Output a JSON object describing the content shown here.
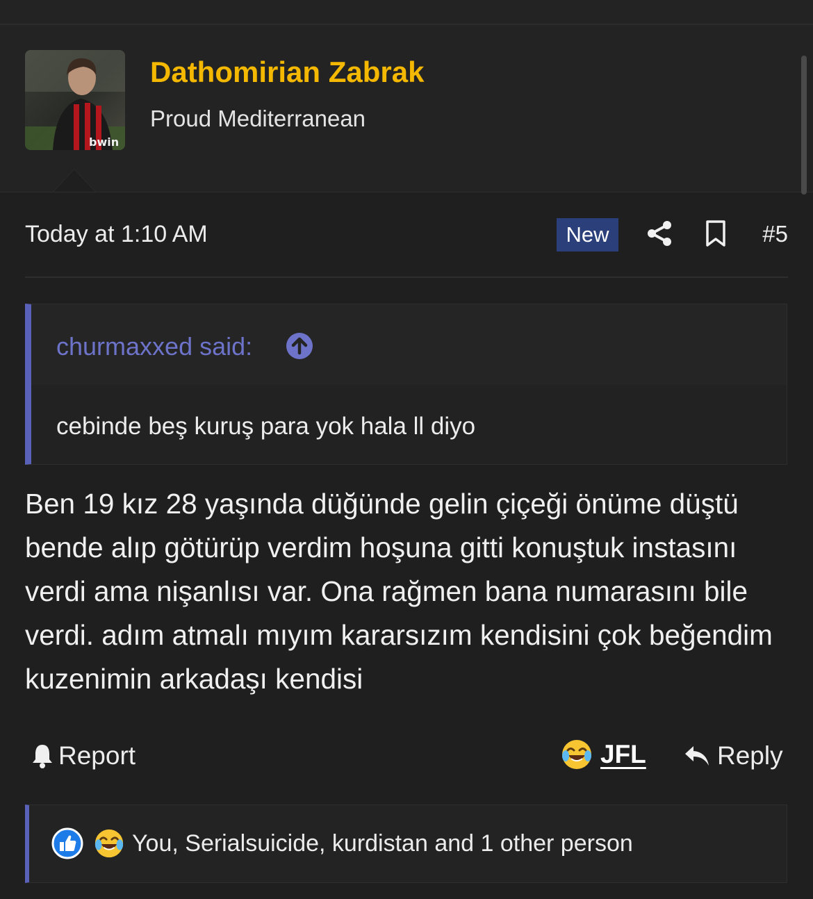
{
  "user": {
    "name": "Dathomirian Zabrak",
    "title": "Proud Mediterranean"
  },
  "post": {
    "timestamp": "Today at 1:10 AM",
    "badge": "New",
    "number": "#5",
    "quote": {
      "author": "churmaxxed said:",
      "text": "cebinde beş kuruş para yok hala ll diyo"
    },
    "body": "Ben 19 kız 28 yaşında düğünde gelin çiçeği önüme düştü bende alıp götürüp verdim hoşuna gitti konuştuk instasını verdi ama nişanlısı var. Ona rağmen bana numarasını bile verdi. adım atmalı mıyım kararsızım kendisini çok beğendim kuzenimin arkadaşı kendisi"
  },
  "actions": {
    "report": "Report",
    "reaction": "JFL",
    "reply": "Reply"
  },
  "reactions_summary": "You, Serialsuicide, kurdistan and 1 other person",
  "colors": {
    "background": "#1f1f1f",
    "username": "#f5b800",
    "quote_accent": "#5a61b8",
    "badge_new": "#2b3f7a"
  },
  "icons": [
    "share-icon",
    "bookmark-icon",
    "arrow-up-circle-icon",
    "bell-icon",
    "laughing-crying-icon",
    "reply-arrow-icon",
    "thumbs-up-icon"
  ]
}
